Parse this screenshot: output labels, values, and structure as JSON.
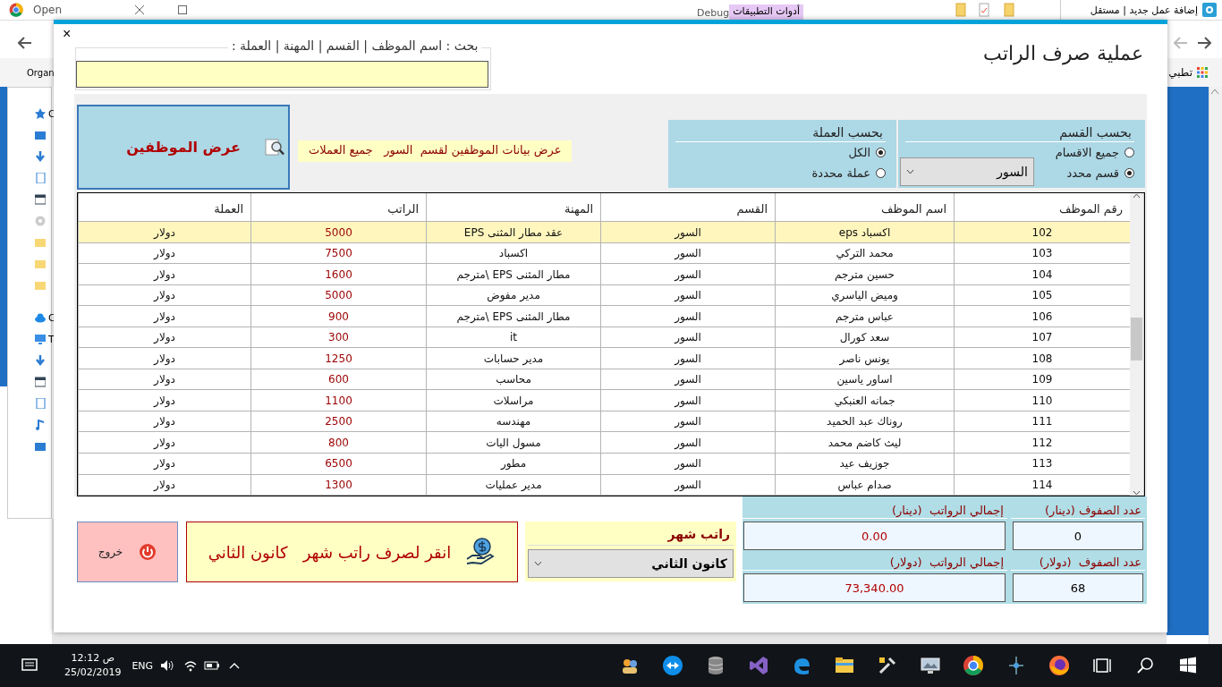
{
  "background": {
    "left_tab_title": "Open",
    "debug_label": "Debug",
    "tools_tab": "أدوات التطبيقات",
    "right_tab_title": "إضافة عمل جديد | مستقل",
    "bookmark_left": "Organ",
    "bookmark_right": "تطبي",
    "sidebar_letters": [
      "C",
      "C",
      "T"
    ]
  },
  "dialog": {
    "title": "عملية صرف الراتب",
    "close": "×",
    "search_label": "بحث : اسم الموظف | القسم | المهنة | العملة :",
    "show_button": "عرض الموظفين",
    "filter_summary": "عرض بيانات الموظفين لقسم  السور   جميع العملات",
    "currency_filter": {
      "title": "بحسب العملة",
      "options": [
        {
          "label": "الكل",
          "selected": true
        },
        {
          "label": "عملة محددة",
          "selected": false
        }
      ]
    },
    "department_filter": {
      "title": "بحسب القسم",
      "options": [
        {
          "label": "جميع الاقسام",
          "selected": false
        },
        {
          "label": "قسم محدد",
          "selected": true
        }
      ],
      "combo_value": "السور"
    },
    "table": {
      "columns": [
        {
          "label": "رقم الموظف",
          "kind": "text"
        },
        {
          "label": "اسم الموظف",
          "kind": "text"
        },
        {
          "label": "القسم",
          "kind": "text"
        },
        {
          "label": "المهنة",
          "kind": "text"
        },
        {
          "label": "الراتب",
          "kind": "amount"
        },
        {
          "label": "العملة",
          "kind": "text"
        }
      ],
      "rows": [
        {
          "cells": [
            "102",
            "اكسباد eps",
            "السور",
            "عقد مطار المثنى EPS",
            "5000",
            "دولار"
          ],
          "selected": true
        },
        {
          "cells": [
            "103",
            "محمد التركي",
            "السور",
            "اكسباد",
            "7500",
            "دولار"
          ],
          "selected": false
        },
        {
          "cells": [
            "104",
            "حسين مترجم",
            "السور",
            "مطار المثنى EPS \\مترجم",
            "1600",
            "دولار"
          ],
          "selected": false
        },
        {
          "cells": [
            "105",
            "وميض الياسري",
            "السور",
            "مدير مفوض",
            "5000",
            "دولار"
          ],
          "selected": false
        },
        {
          "cells": [
            "106",
            "عباس مترجم",
            "السور",
            "مطار المثنى EPS \\مترجم",
            "900",
            "دولار"
          ],
          "selected": false
        },
        {
          "cells": [
            "107",
            "سعد كورال",
            "السور",
            "it",
            "300",
            "دولار"
          ],
          "selected": false
        },
        {
          "cells": [
            "108",
            "يونس ناصر",
            "السور",
            "مدير حسابات",
            "1250",
            "دولار"
          ],
          "selected": false
        },
        {
          "cells": [
            "109",
            "اساور ياسين",
            "السور",
            "محاسب",
            "600",
            "دولار"
          ],
          "selected": false
        },
        {
          "cells": [
            "110",
            "جمانه العنبكي",
            "السور",
            "مراسلات",
            "1100",
            "دولار"
          ],
          "selected": false
        },
        {
          "cells": [
            "111",
            "روناك عبد الحميد",
            "السور",
            "مهندسه",
            "2500",
            "دولار"
          ],
          "selected": false
        },
        {
          "cells": [
            "112",
            "ليث كاضم محمد",
            "السور",
            "مسول اليات",
            "800",
            "دولار"
          ],
          "selected": false
        },
        {
          "cells": [
            "113",
            "جوزيف عيد",
            "السور",
            "مطور",
            "6500",
            "دولار"
          ],
          "selected": false
        },
        {
          "cells": [
            "114",
            "صدام عباس",
            "السور",
            "مدير عمليات",
            "1300",
            "دولار"
          ],
          "selected": false
        }
      ]
    },
    "exit_button": "خروج",
    "pay_button": "انقر لصرف راتب شهر   كانون الثاني",
    "month_group": {
      "title": "راتب شهر",
      "value": "كانون الثاني"
    },
    "totals": {
      "rows_dinar_label": "عدد الصفوف (دينار)",
      "total_dinar_label": "إجمالي الرواتب  (دينار)",
      "rows_dinar": "0",
      "total_dinar": "0.00",
      "rows_dollar_label": "عدد الصفوف  (دولار)",
      "total_dollar_label": "إجمالي الرواتب  (دولار)",
      "rows_dollar": "68",
      "total_dollar": "73,340.00"
    }
  },
  "taskbar": {
    "time": "12:12 ص",
    "date": "25/02/2019",
    "language": "ENG"
  }
}
